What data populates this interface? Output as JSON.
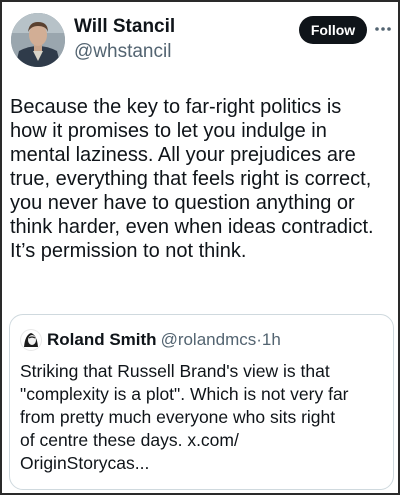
{
  "tweet": {
    "author": {
      "display_name": "Will Stancil",
      "handle": "@whstancil"
    },
    "follow_label": "Follow",
    "more_icon": "more-horizontal-icon",
    "text": "Because the key to far-right politics is\nhow it promises to let you indulge in\nmental laziness. All your prejudices are\ntrue, everything that feels right is correct,\nyou never have to question anything or\nthink harder, even when ideas contradict.\nIt’s permission to not think."
  },
  "quoted_tweet": {
    "author": {
      "display_name": "Roland Smith",
      "handle": "@rolandmcs"
    },
    "separator": "·",
    "time": "1h",
    "text": "Striking that Russell Brand's view is that\n\"complexity is a plot\". Which is not very far\nfrom pretty much everyone who sits right\nof centre these days. x.com/\nOriginStorycas..."
  },
  "colors": {
    "text_primary": "#0f1419",
    "text_secondary": "#536471",
    "follow_button_bg": "#0f1419",
    "follow_button_text": "#ffffff",
    "card_border": "#cfd9de",
    "frame_border": "#2a2a2a"
  }
}
